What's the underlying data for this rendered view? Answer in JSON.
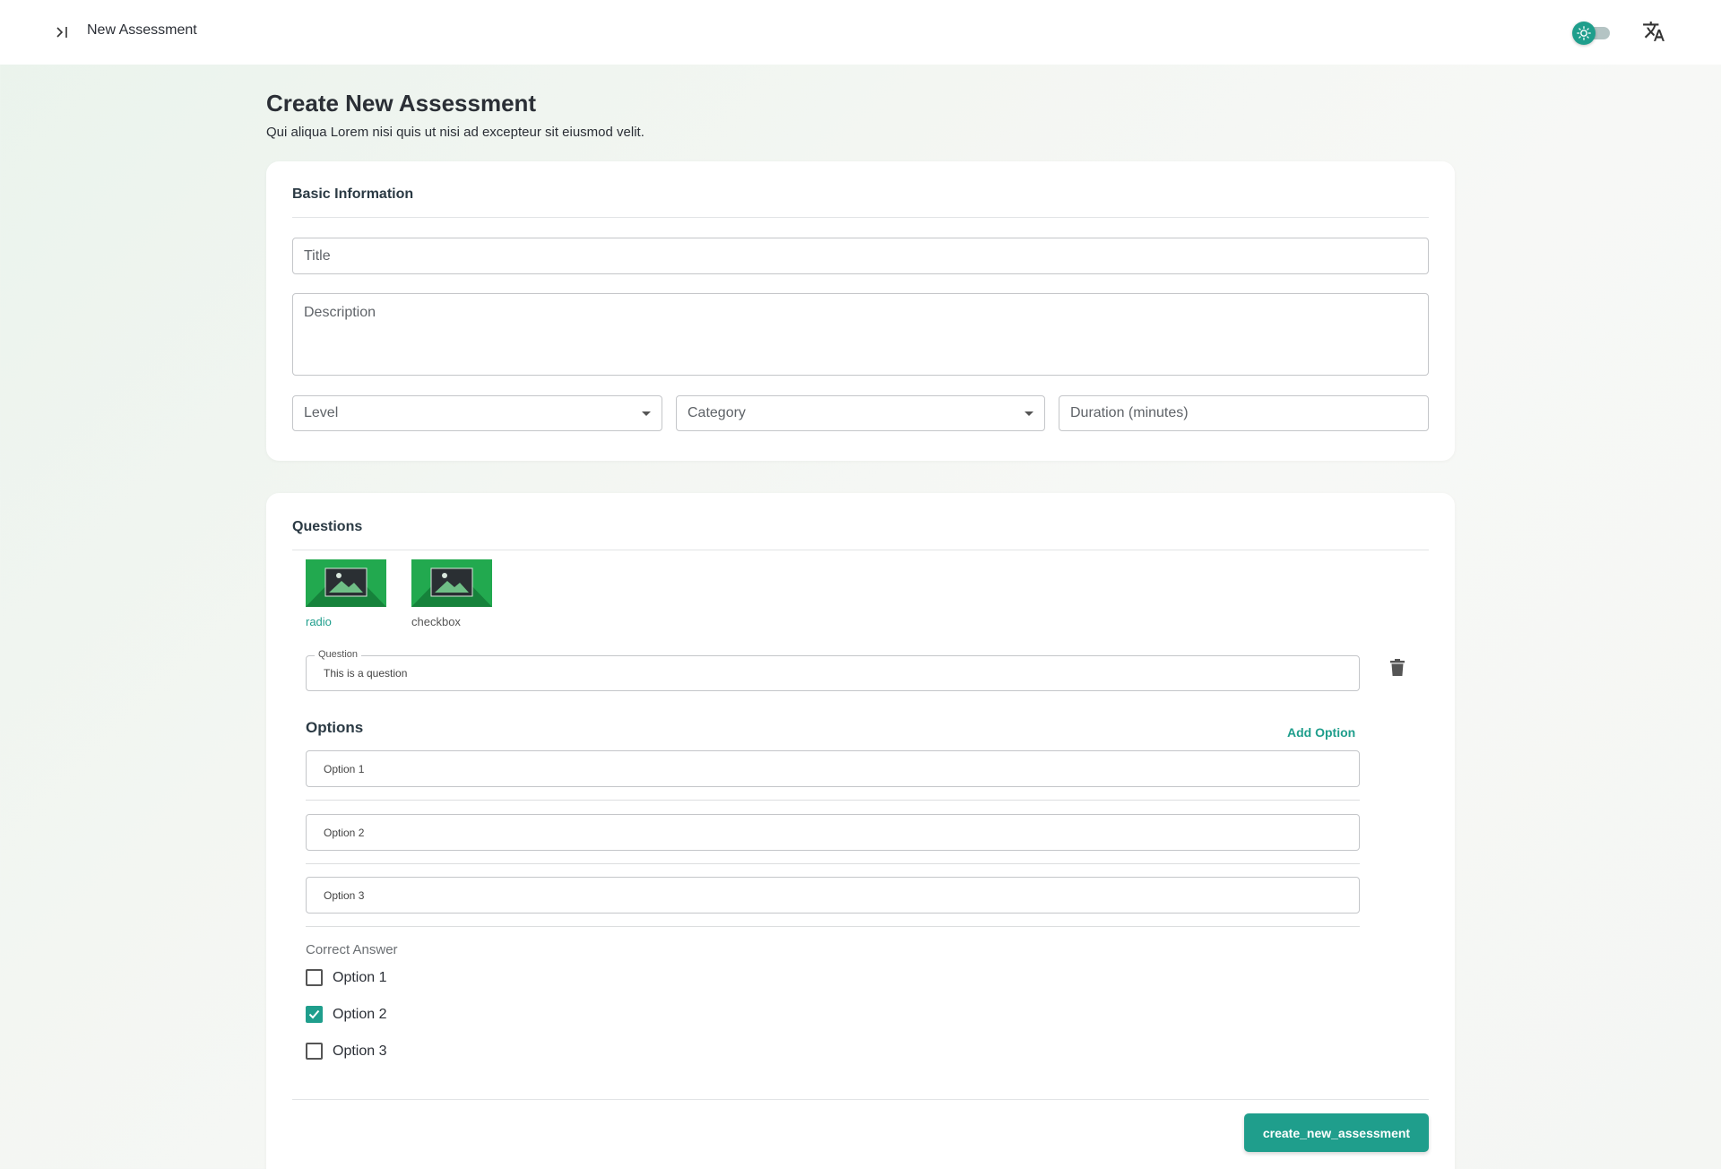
{
  "header": {
    "title": "New Assessment",
    "collapse_icon": "sidebar-expand-icon",
    "theme_icon": "sun-icon",
    "language_icon": "translate-icon",
    "accent_color": "#1f9e8c"
  },
  "page": {
    "title": "Create New Assessment",
    "subtitle": "Qui aliqua Lorem nisi quis ut nisi ad excepteur sit eiusmod velit."
  },
  "basic_info": {
    "heading": "Basic Information",
    "title_placeholder": "Title",
    "description_placeholder": "Description",
    "level_placeholder": "Level",
    "category_placeholder": "Category",
    "duration_placeholder": "Duration (minutes)"
  },
  "questions": {
    "heading": "Questions",
    "types": [
      {
        "label": "radio",
        "active": true
      },
      {
        "label": "checkbox",
        "active": false
      }
    ],
    "question_legend": "Question",
    "question_value": "This is a question",
    "options_title": "Options",
    "add_option_label": "Add Option",
    "options": [
      "Option 1",
      "Option 2",
      "Option 3"
    ],
    "correct_answer_label": "Correct Answer",
    "correct_answers": [
      {
        "label": "Option 1",
        "checked": false
      },
      {
        "label": "Option 2",
        "checked": true
      },
      {
        "label": "Option 3",
        "checked": false
      }
    ]
  },
  "footer": {
    "submit_label": "create_new_assessment"
  }
}
